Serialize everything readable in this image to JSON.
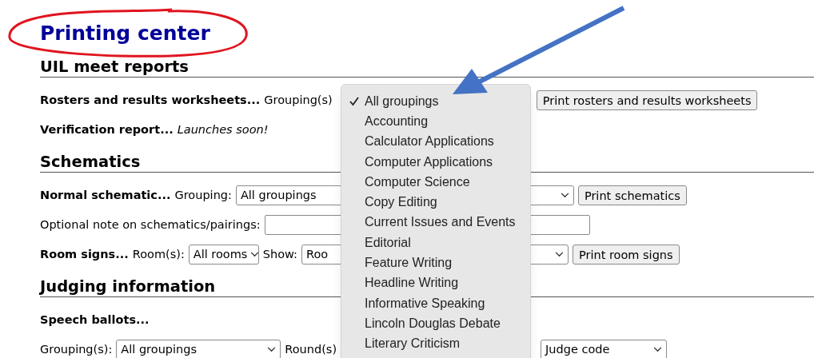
{
  "title": "Printing center",
  "sections": [
    {
      "heading": "UIL meet reports",
      "lines": [
        {
          "controls": [
            {
              "kind": "label",
              "text": "Rosters and results worksheets..."
            },
            {
              "kind": "text",
              "text": "Grouping(s)"
            },
            {
              "kind": "button",
              "text": "Print rosters and results worksheets"
            }
          ]
        },
        {
          "controls": [
            {
              "kind": "label",
              "text": "Verification report..."
            },
            {
              "kind": "note",
              "text": "Launches soon!"
            }
          ]
        }
      ]
    },
    {
      "heading": "Schematics",
      "lines": [
        {
          "controls": [
            {
              "kind": "label",
              "text": "Normal schematic..."
            },
            {
              "kind": "text",
              "text": "Grouping:"
            },
            {
              "kind": "select",
              "value": "All groupings"
            },
            {
              "kind": "button",
              "text": "Print schematics"
            }
          ]
        },
        {
          "controls": [
            {
              "kind": "text",
              "text": "Optional note on schematics/pairings:"
            },
            {
              "kind": "input"
            }
          ]
        },
        {
          "controls": [
            {
              "kind": "label",
              "text": "Room signs..."
            },
            {
              "kind": "text",
              "text": "Room(s):"
            },
            {
              "kind": "select",
              "value": "All rooms"
            },
            {
              "kind": "text",
              "text": "Show:"
            },
            {
              "kind": "select",
              "value": "Roo"
            },
            {
              "kind": "button",
              "text": "Print room signs"
            }
          ]
        }
      ]
    },
    {
      "heading": "Judging information",
      "lines": [
        {
          "controls": [
            {
              "kind": "label",
              "text": "Speech ballots..."
            }
          ]
        },
        {
          "controls": [
            {
              "kind": "text",
              "text": "Grouping(s):"
            },
            {
              "kind": "select",
              "value": "All groupings"
            },
            {
              "kind": "text",
              "text": "Round(s)"
            },
            {
              "kind": "select",
              "value": "Judge code"
            }
          ]
        }
      ]
    }
  ],
  "dropdown": [
    {
      "label": "All groupings",
      "selected": true
    },
    {
      "label": "Accounting",
      "selected": false
    },
    {
      "label": "Calculator Applications",
      "selected": false
    },
    {
      "label": "Computer Applications",
      "selected": false
    },
    {
      "label": "Computer Science",
      "selected": false
    },
    {
      "label": "Copy Editing",
      "selected": false
    },
    {
      "label": "Current Issues and Events",
      "selected": false
    },
    {
      "label": "Editorial",
      "selected": false
    },
    {
      "label": "Feature Writing",
      "selected": false
    },
    {
      "label": "Headline Writing",
      "selected": false
    },
    {
      "label": "Informative Speaking",
      "selected": false
    },
    {
      "label": "Lincoln Douglas Debate",
      "selected": false
    },
    {
      "label": "Literary Criticism",
      "selected": false
    }
  ]
}
